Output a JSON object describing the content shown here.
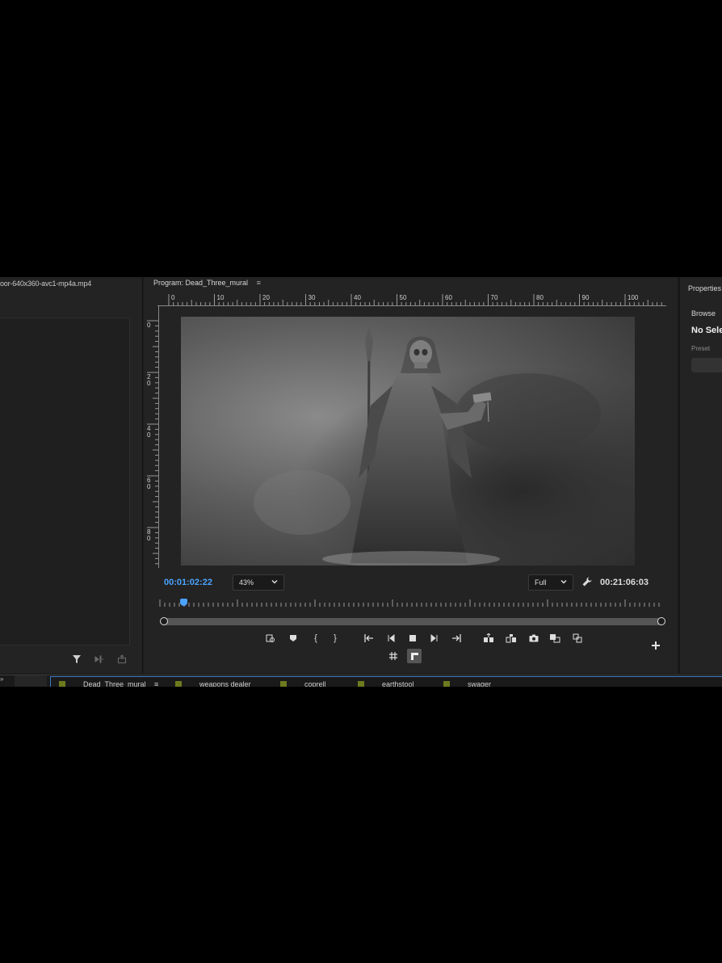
{
  "source": {
    "title": "oor-640x360-avc1-mp4a.mp4"
  },
  "program": {
    "title": "Program: Dead_Three_mural",
    "menu_icon": "hamburger-icon",
    "ruler_top_labels": [
      "0",
      "10",
      "20",
      "30",
      "40",
      "50",
      "60",
      "70",
      "80",
      "90",
      "100"
    ],
    "ruler_left_labels": [
      "0",
      "2\n0",
      "4\n0",
      "6\n0",
      "8\n0"
    ],
    "current_timecode": "00:01:02:22",
    "zoom": "43%",
    "quality": "Full",
    "duration_timecode": "00:21:06:03",
    "playhead_position": 0.05
  },
  "properties": {
    "title": "Properties",
    "browse": "Browse",
    "no_selection": "No Sele",
    "preset_label": "Preset"
  },
  "timeline": {
    "left_label": "»",
    "tabs": [
      "Dead_Three_mural",
      "weapons dealer",
      "coprell",
      "earthstool",
      "swager"
    ],
    "tab_menu": "≡"
  },
  "colors": {
    "accent": "#4aa3ff",
    "panel": "#232323",
    "bin_label": "#6e7a1e"
  }
}
